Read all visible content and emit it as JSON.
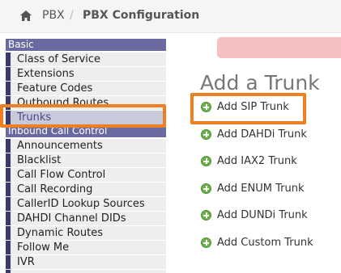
{
  "breadcrumb": {
    "home_icon": "home-icon",
    "root": "PBX",
    "separator": "/",
    "current": "PBX Configuration"
  },
  "sidebar": {
    "section_basic": "Basic",
    "basic_items": [
      "Class of Service",
      "Extensions",
      "Feature Codes",
      "Outbound Routes",
      "Trunks"
    ],
    "section_inbound": "Inbound Call Control",
    "inbound_items": [
      "Announcements",
      "Blacklist",
      "Call Flow Control",
      "Call Recording",
      "CallerID Lookup Sources",
      "DAHDI Channel DIDs",
      "Dynamic Routes",
      "Follow Me",
      "IVR"
    ],
    "selected": "Trunks"
  },
  "main": {
    "title": "Add a Trunk",
    "links": [
      "Add SIP Trunk",
      "Add DAHDi Trunk",
      "Add IAX2 Trunk",
      "Add ENUM Trunk",
      "Add DUNDi Trunk",
      "Add Custom Trunk"
    ]
  },
  "colors": {
    "accent_highlight": "#f07f22",
    "sidebar_header": "#6a6aa0",
    "add_icon": "#6cb14a",
    "alert_bar": "#f5c0c0"
  }
}
